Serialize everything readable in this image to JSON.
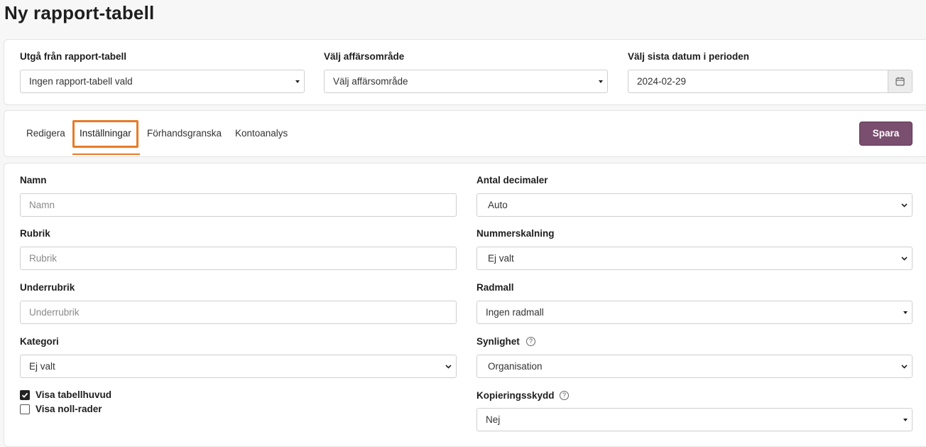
{
  "page": {
    "title": "Ny rapport-tabell"
  },
  "top": {
    "base_label": "Utgå från rapport-tabell",
    "base_value": "Ingen rapport-tabell vald",
    "area_label": "Välj affärsområde",
    "area_value": "Välj affärsområde",
    "date_label": "Välj sista datum i perioden",
    "date_value": "2024-02-29"
  },
  "tabs": [
    {
      "label": "Redigera"
    },
    {
      "label": "Inställningar",
      "active": true
    },
    {
      "label": "Förhandsgranska"
    },
    {
      "label": "Kontoanalys"
    }
  ],
  "save_label": "Spara",
  "form": {
    "name_label": "Namn",
    "name_placeholder": "Namn",
    "rubrik_label": "Rubrik",
    "rubrik_placeholder": "Rubrik",
    "underrubrik_label": "Underrubrik",
    "underrubrik_placeholder": "Underrubrik",
    "kategori_label": "Kategori",
    "kategori_value": "Ej valt",
    "show_header_label": "Visa tabellhuvud",
    "show_header_checked": true,
    "show_zero_label": "Visa noll-rader",
    "show_zero_checked": false,
    "decimals_label": "Antal decimaler",
    "decimals_value": "Auto",
    "scaling_label": "Nummerskalning",
    "scaling_value": "Ej valt",
    "row_template_label": "Radmall",
    "row_template_value": "Ingen radmall",
    "visibility_label": "Synlighet",
    "visibility_value": "Organisation",
    "copy_protection_label": "Kopieringsskydd",
    "copy_protection_value": "Nej",
    "help_glyph": "?"
  },
  "colors": {
    "accent_orange": "#e87b28",
    "save_button": "#7a4e6f"
  },
  "icons": {
    "calendar": "calendar-icon",
    "dropdown": "chevron-down-icon",
    "caret": "caret-down-icon",
    "help": "help-circle-icon",
    "check": "checkmark-icon"
  }
}
